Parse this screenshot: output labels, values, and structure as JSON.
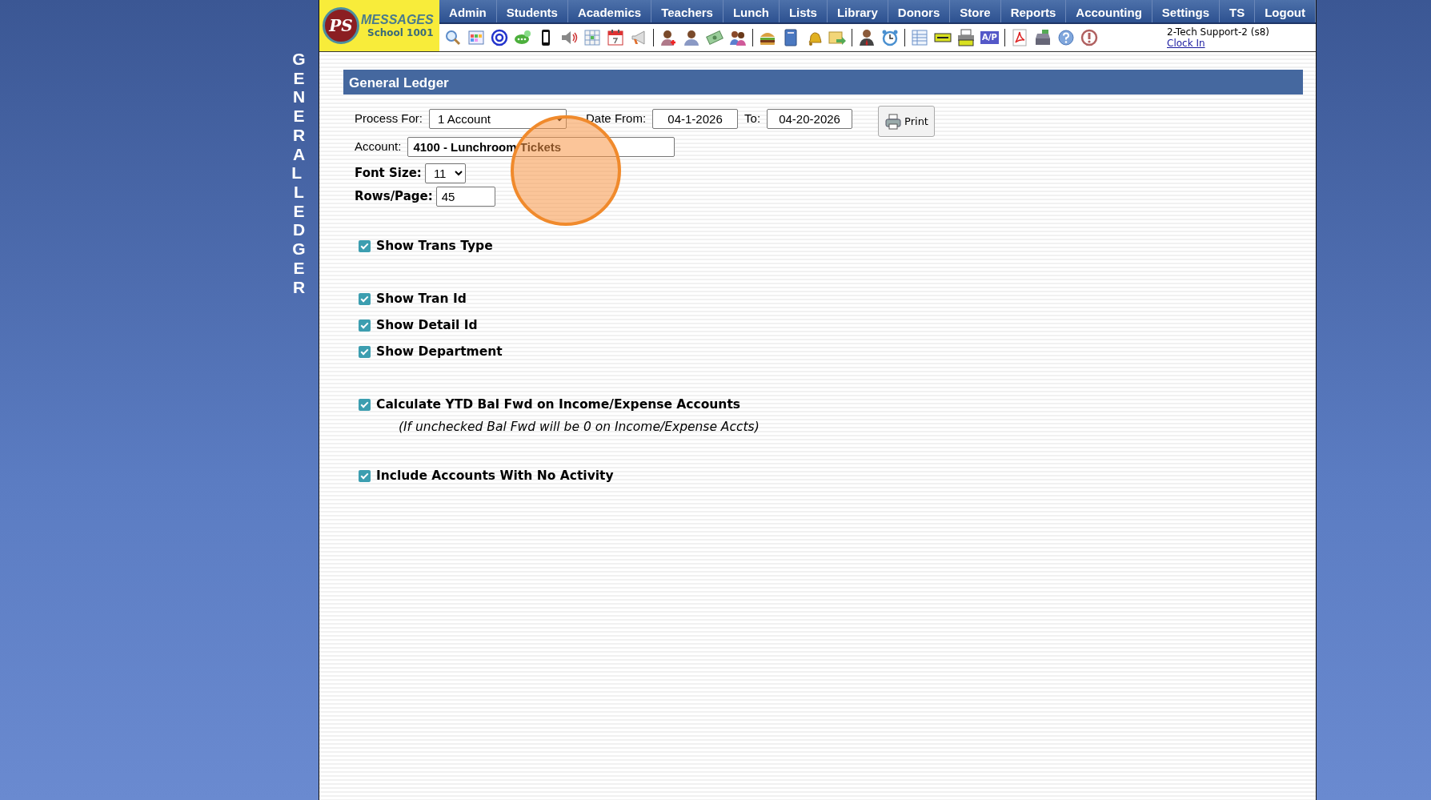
{
  "side_title": "GENERAL LEDGER",
  "logo": {
    "initials": "PS",
    "brand": "MESSAGES",
    "school": "School 1001"
  },
  "menu": [
    "Admin",
    "Students",
    "Academics",
    "Teachers",
    "Lunch",
    "Lists",
    "Library",
    "Donors",
    "Store",
    "Reports",
    "Accounting",
    "Settings",
    "TS",
    "Logout"
  ],
  "toolbar": [
    {
      "kind": "search"
    },
    {
      "kind": "grid"
    },
    {
      "kind": "at"
    },
    {
      "kind": "chat"
    },
    {
      "kind": "phone"
    },
    {
      "kind": "speaker"
    },
    {
      "kind": "calendar"
    },
    {
      "kind": "calendar-date"
    },
    {
      "kind": "megaphone"
    },
    {
      "kind": "separator"
    },
    {
      "kind": "person-plus"
    },
    {
      "kind": "person"
    },
    {
      "kind": "money"
    },
    {
      "kind": "people"
    },
    {
      "kind": "separator"
    },
    {
      "kind": "burger"
    },
    {
      "kind": "book"
    },
    {
      "kind": "bell"
    },
    {
      "kind": "folder-arrow"
    },
    {
      "kind": "separator"
    },
    {
      "kind": "businessman"
    },
    {
      "kind": "clock"
    },
    {
      "kind": "separator"
    },
    {
      "kind": "table"
    },
    {
      "kind": "card"
    },
    {
      "kind": "printer"
    },
    {
      "kind": "label",
      "label": "A/P"
    },
    {
      "kind": "separator"
    },
    {
      "kind": "pdf"
    },
    {
      "kind": "register"
    },
    {
      "kind": "help"
    },
    {
      "kind": "alert"
    }
  ],
  "user": {
    "name": "2-Tech Support-2 (s8)",
    "link": "Clock In"
  },
  "panel": {
    "title": "General Ledger",
    "process_for": {
      "label": "Process For:",
      "value": "1 Account"
    },
    "date_from": {
      "label": "Date From:",
      "value": "04-1-2026"
    },
    "date_to": {
      "label": "To:",
      "value": "04-20-2026"
    },
    "print": "Print",
    "account": {
      "label": "Account:",
      "value": "4100 - Lunchroom Tickets"
    },
    "font_size": {
      "label": "Font Size:",
      "value": "11"
    },
    "rows_per_page": {
      "label": "Rows/Page:",
      "value": "45"
    },
    "option_groups": [
      [
        {
          "label": "Show Trans Type",
          "checked": true
        }
      ],
      [
        {
          "label": "Show Tran Id",
          "checked": true
        },
        {
          "label": "Show Detail Id",
          "checked": true
        },
        {
          "label": "Show Department",
          "checked": true
        }
      ],
      [
        {
          "label": "Calculate YTD Bal Fwd on Income/Expense Accounts",
          "checked": true,
          "note": "(If unchecked Bal Fwd will be 0 on Income/Expense Accts)"
        }
      ],
      [
        {
          "label": "Include Accounts With No Activity",
          "checked": true
        }
      ]
    ]
  }
}
